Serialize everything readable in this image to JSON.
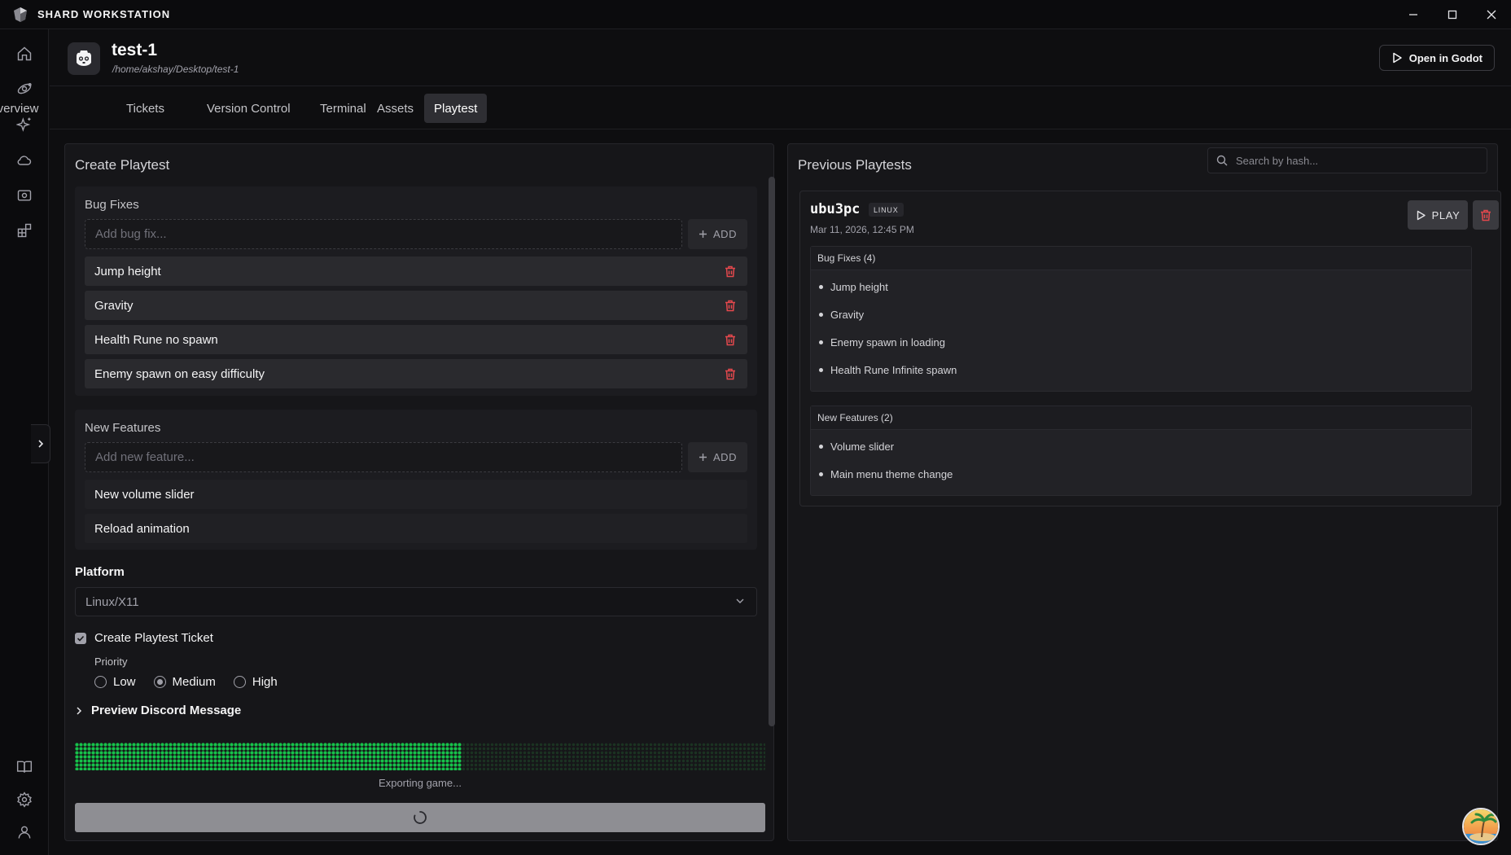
{
  "app": {
    "title": "SHARD WORKSTATION"
  },
  "project": {
    "name": "test-1",
    "path": "/home/akshay/Desktop/test-1",
    "open_button": "Open in Godot"
  },
  "tabs": [
    {
      "label": "Overview"
    },
    {
      "label": "Tickets"
    },
    {
      "label": "Version Control"
    },
    {
      "label": "Terminal"
    },
    {
      "label": "Assets"
    },
    {
      "label": "Playtest",
      "active": true
    }
  ],
  "create": {
    "title": "Create Playtest",
    "bug_fixes": {
      "label": "Bug Fixes",
      "placeholder": "Add bug fix...",
      "add_label": "ADD",
      "items": [
        "Jump height",
        "Gravity",
        "Health Rune no spawn",
        "Enemy spawn on easy difficulty"
      ]
    },
    "features": {
      "label": "New Features",
      "placeholder": "Add new feature...",
      "add_label": "ADD",
      "items": [
        "New volume slider",
        "Reload animation"
      ]
    },
    "platform": {
      "label": "Platform",
      "value": "Linux/X11"
    },
    "ticket": {
      "label": "Create Playtest Ticket",
      "checked": true
    },
    "priority": {
      "label": "Priority",
      "options": [
        "Low",
        "Medium",
        "High"
      ],
      "selected": "Medium"
    },
    "preview_label": "Preview Discord Message",
    "progress": {
      "fraction": 0.56,
      "text": "Exporting game..."
    }
  },
  "previous": {
    "title": "Previous Playtests",
    "search_placeholder": "Search by hash...",
    "entries": [
      {
        "hash": "ubu3pc",
        "os": "LINUX",
        "date": "Mar 11, 2026, 12:45 PM",
        "play_label": "PLAY",
        "bug_fixes_title": "Bug Fixes (4)",
        "bug_fixes": [
          "Jump height",
          "Gravity",
          "Enemy spawn in loading",
          "Health Rune Infinite spawn"
        ],
        "features_title": "New Features (2)",
        "features": [
          "Volume slider",
          "Main menu theme change"
        ]
      }
    ]
  },
  "colors": {
    "accent_green": "#16c24a",
    "danger": "#e5484d",
    "background": "#0e0e10"
  },
  "icons": [
    "home-icon",
    "orbit-icon",
    "sparkles-icon",
    "cloud-icon",
    "eye-icon",
    "blocks-icon",
    "book-icon",
    "settings-icon",
    "user-icon",
    "godot-icon",
    "trash-icon",
    "plus-icon",
    "play-icon",
    "search-icon",
    "chevron-right-icon",
    "chevron-down-icon",
    "spinner-icon"
  ]
}
